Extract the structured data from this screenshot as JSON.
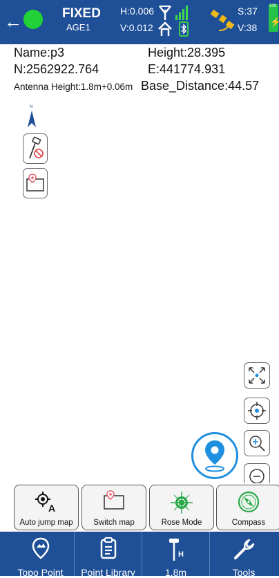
{
  "status": {
    "fix": "FIXED",
    "age": "AGE1",
    "h_precision": "H:0.006",
    "v_precision": "V:0.012",
    "satellites_used": "S:37",
    "satellites_visible": "V:38",
    "battery_label": "100",
    "fix_color": "#22d137"
  },
  "point": {
    "name": "Name:p3",
    "height": "Height:28.395",
    "north": "N:2562922.764",
    "east": "E:441774.931",
    "antenna_height": "Antenna Height:1.8m+0.06m",
    "base_distance": "Base_Distance:44.57"
  },
  "north_label": "N",
  "mode_buttons": [
    {
      "label": "Auto jump map",
      "icon": "target-a-icon"
    },
    {
      "label": "Switch map",
      "icon": "map-switch-icon"
    },
    {
      "label": "Rose Mode",
      "icon": "compass-rose-icon"
    },
    {
      "label": "Compass",
      "icon": "compass-icon"
    }
  ],
  "bottom_nav": [
    {
      "label": "Topo Point",
      "icon": "location-pin-icon"
    },
    {
      "label": "Point Library",
      "icon": "clipboard-icon"
    },
    {
      "label": "1.8m",
      "icon": "antenna-height-icon"
    },
    {
      "label": "Tools",
      "icon": "wrench-icon"
    }
  ],
  "colors": {
    "bar_blue": "#1f4f97",
    "accent_blue": "#1f8fe0",
    "compass_green": "#2aa84a"
  }
}
